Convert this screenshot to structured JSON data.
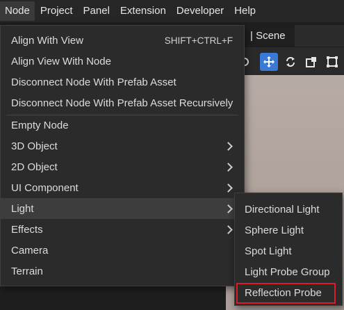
{
  "menubar": {
    "items": [
      "Node",
      "Project",
      "Panel",
      "Extension",
      "Developer",
      "Help"
    ]
  },
  "scene": {
    "tab_label": "| Scene",
    "tools": [
      "move-tool-icon",
      "rotate-tool-icon",
      "scale-tool-icon",
      "rect-tool-icon"
    ]
  },
  "node_menu": {
    "items": [
      {
        "label": "Align With View",
        "shortcut": "SHIFT+CTRL+F"
      },
      {
        "label": "Align View With Node"
      },
      {
        "label": "Disconnect Node With Prefab Asset"
      },
      {
        "label": "Disconnect Node With Prefab Asset Recursively"
      },
      {
        "label": "Empty Node"
      },
      {
        "label": "3D Object",
        "submenu": true
      },
      {
        "label": "2D Object",
        "submenu": true
      },
      {
        "label": "UI Component",
        "submenu": true
      },
      {
        "label": "Light",
        "submenu": true,
        "highlighted": true
      },
      {
        "label": "Effects",
        "submenu": true
      },
      {
        "label": "Camera"
      },
      {
        "label": "Terrain"
      }
    ]
  },
  "light_submenu": {
    "items": [
      "Directional Light",
      "Sphere Light",
      "Spot Light",
      "Light Probe Group",
      "Reflection Probe"
    ],
    "annotated_item": "Reflection Probe",
    "annotation_color": "#e11b24"
  },
  "colors": {
    "menu_bg": "#2b2b2b",
    "highlight_bg": "#3d3d3d",
    "tool_active": "#3b79d6"
  }
}
